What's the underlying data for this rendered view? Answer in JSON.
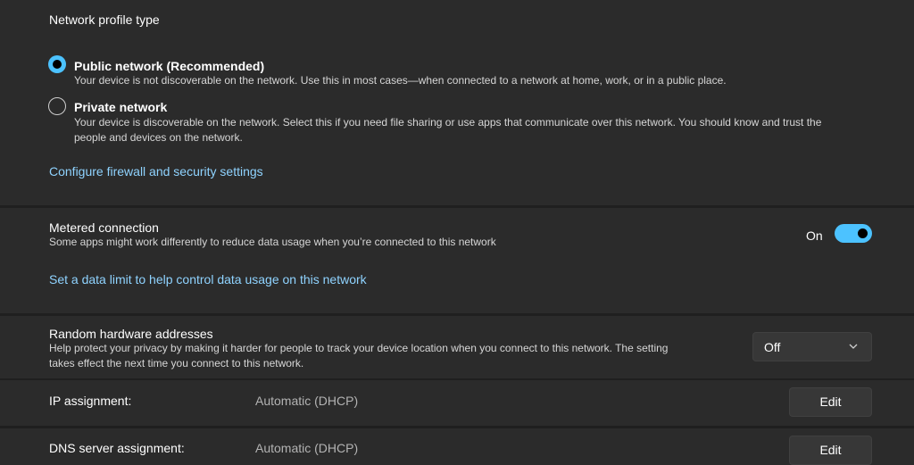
{
  "profile": {
    "section_title": "Network profile type",
    "public": {
      "title": "Public network (Recommended)",
      "description": "Your device is not discoverable on the network. Use this in most cases—when connected to a network at home, work, or in a public place.",
      "checked": true
    },
    "private": {
      "title": "Private network",
      "description_line1": "Your device is discoverable on the network. Select this if you need file sharing or use apps that communicate over this network. You should know and trust the",
      "description_line2": "people and devices on the network.",
      "checked": false
    },
    "firewall_link": "Configure firewall and security settings"
  },
  "metered": {
    "title": "Metered connection",
    "description": "Some apps might work differently to reduce data usage when you’re connected to this network",
    "toggle_label": "On",
    "toggle_on": true,
    "data_limit_link": "Set a data limit to help control data usage on this network"
  },
  "random_hw": {
    "title": "Random hardware addresses",
    "description_line1": "Help protect your privacy by making it harder for people to track your device location when you connect to this network. The setting",
    "description_line2": "takes effect the next time you connect to this network.",
    "dropdown_value": "Off"
  },
  "ip": {
    "label": "IP assignment:",
    "value": "Automatic (DHCP)",
    "edit_label": "Edit"
  },
  "dns": {
    "label": "DNS server assignment:",
    "value": "Automatic (DHCP)",
    "edit_label": "Edit"
  },
  "colors": {
    "accent": "#4cc2ff",
    "link": "#8fd3ff",
    "card": "#2b2b2b",
    "background": "#1f1f1f"
  }
}
